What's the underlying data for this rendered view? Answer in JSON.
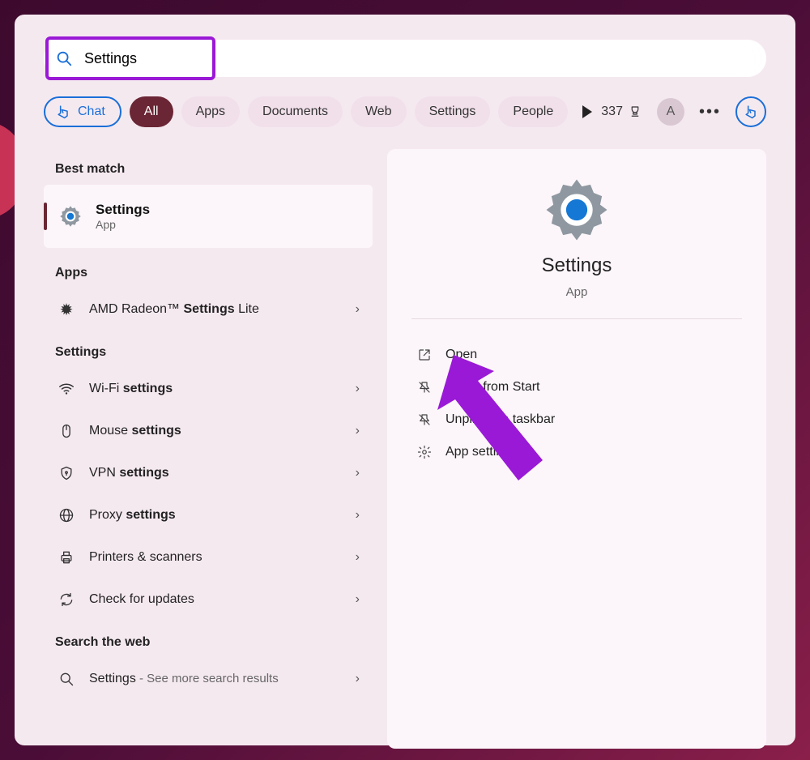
{
  "search": {
    "query": "Settings"
  },
  "chips": {
    "chat": "Chat",
    "all": "All",
    "apps": "Apps",
    "documents": "Documents",
    "web": "Web",
    "settings": "Settings",
    "people": "People"
  },
  "topRight": {
    "points": "337",
    "avatarLetter": "A"
  },
  "left": {
    "bestMatchHeader": "Best match",
    "bestMatch": {
      "title": "Settings",
      "subtitle": "App"
    },
    "appsHeader": "Apps",
    "amd": {
      "prefix": "AMD Radeon™ ",
      "bold": "Settings",
      "suffix": " Lite"
    },
    "settingsHeader": "Settings",
    "wifi": {
      "prefix": "Wi-Fi ",
      "bold": "settings"
    },
    "mouse": {
      "prefix": "Mouse ",
      "bold": "settings"
    },
    "vpn": {
      "prefix": "VPN ",
      "bold": "settings"
    },
    "proxy": {
      "prefix": "Proxy ",
      "bold": "settings"
    },
    "printers": {
      "text": "Printers & scanners"
    },
    "updates": {
      "text": "Check for updates"
    },
    "webHeader": "Search the web",
    "webItem": {
      "title": "Settings",
      "sub": " - See more search results"
    }
  },
  "right": {
    "title": "Settings",
    "subtitle": "App",
    "actions": {
      "open": "Open",
      "unpinStart": "Unpin from Start",
      "unpinTaskbar": "Unpin from taskbar",
      "appSettings": "App settings"
    }
  }
}
